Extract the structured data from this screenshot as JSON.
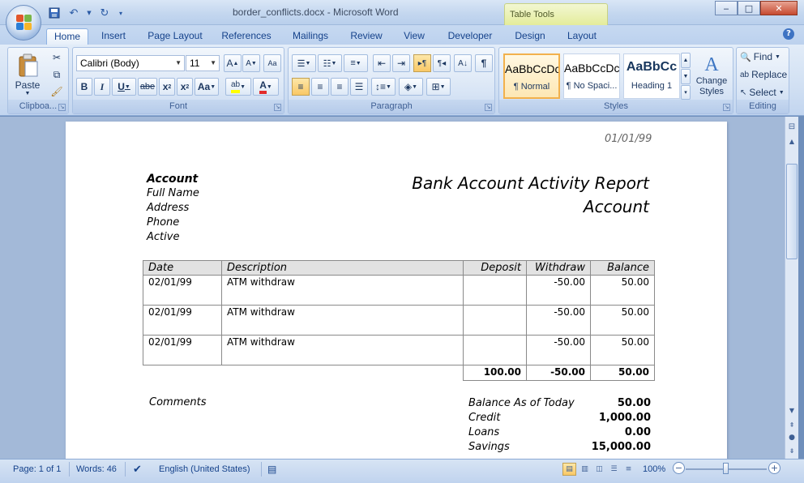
{
  "window": {
    "title": "border_conflicts.docx - Microsoft Word",
    "contextual_tab_group": "Table Tools",
    "controls": {
      "minimize": "‒",
      "maximize": "□",
      "close": "✕"
    }
  },
  "quick_access": {
    "save_icon": "save-icon",
    "undo_icon": "undo-icon",
    "redo_icon": "redo-icon"
  },
  "tabs": [
    "Home",
    "Insert",
    "Page Layout",
    "References",
    "Mailings",
    "Review",
    "View",
    "Developer",
    "Design",
    "Layout"
  ],
  "active_tab": "Home",
  "ribbon": {
    "clipboard": {
      "label": "Clipboa...",
      "paste": "Paste"
    },
    "font": {
      "label": "Font",
      "font_name": "Calibri (Body)",
      "font_size": "11"
    },
    "paragraph": {
      "label": "Paragraph"
    },
    "styles": {
      "label": "Styles",
      "items": [
        {
          "sample": "AaBbCcDc",
          "name": "¶ Normal"
        },
        {
          "sample": "AaBbCcDc",
          "name": "¶ No Spaci..."
        },
        {
          "sample": "AaBbCc",
          "name": "Heading 1"
        }
      ],
      "change_styles": "Change Styles"
    },
    "editing": {
      "label": "Editing",
      "find": "Find",
      "replace": "Replace",
      "select": "Select"
    }
  },
  "document": {
    "date": "01/01/99",
    "account_heading": "Account",
    "account_fields": [
      "Full Name",
      "Address",
      "Phone",
      "Active"
    ],
    "report_title_line1": "Bank Account Activity Report",
    "report_title_line2": "Account",
    "table": {
      "headers": [
        "Date",
        "Description",
        "Deposit",
        "Withdraw",
        "Balance"
      ],
      "rows": [
        [
          "02/01/99",
          "ATM withdraw",
          "",
          "-50.00",
          "50.00"
        ],
        [
          "02/01/99",
          "ATM withdraw",
          "",
          "-50.00",
          "50.00"
        ],
        [
          "02/01/99",
          "ATM withdraw",
          "",
          "-50.00",
          "50.00"
        ]
      ],
      "totals": [
        "100.00",
        "-50.00",
        "50.00"
      ]
    },
    "comments_label": "Comments",
    "summary": [
      {
        "label": "Balance As of Today",
        "value": "50.00"
      },
      {
        "label": "Credit",
        "value": "1,000.00"
      },
      {
        "label": "Loans",
        "value": "0.00"
      },
      {
        "label": "Savings",
        "value": "15,000.00"
      }
    ]
  },
  "status_bar": {
    "page": "Page: 1 of 1",
    "words": "Words: 46",
    "language": "English (United States)",
    "zoom": "100%"
  }
}
